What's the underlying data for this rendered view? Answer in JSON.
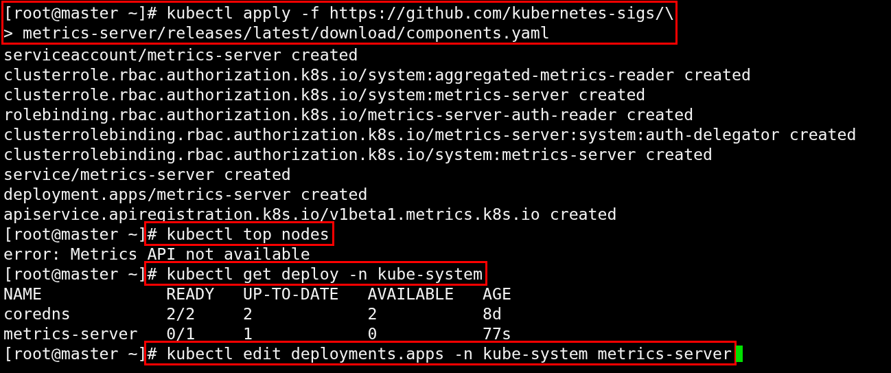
{
  "terminal": {
    "blocks": [
      {
        "prompt": "[root@master ~]",
        "input": [
          "# kubectl apply -f https://github.com/kubernetes-sigs/\\",
          "> metrics-server/releases/latest/download/components.yaml"
        ],
        "boxed": true,
        "box_includes_prompt": true,
        "output": [
          "serviceaccount/metrics-server created",
          "clusterrole.rbac.authorization.k8s.io/system:aggregated-metrics-reader created",
          "clusterrole.rbac.authorization.k8s.io/system:metrics-server created",
          "rolebinding.rbac.authorization.k8s.io/metrics-server-auth-reader created",
          "clusterrolebinding.rbac.authorization.k8s.io/metrics-server:system:auth-delegator created",
          "clusterrolebinding.rbac.authorization.k8s.io/system:metrics-server created",
          "service/metrics-server created",
          "deployment.apps/metrics-server created",
          "apiservice.apiregistration.k8s.io/v1beta1.metrics.k8s.io created"
        ]
      },
      {
        "prompt": "[root@master ~]",
        "input": [
          "# kubectl top nodes"
        ],
        "boxed": true,
        "box_includes_prompt": false,
        "output": [
          "error: Metrics API not available"
        ]
      },
      {
        "prompt": "[root@master ~]",
        "input": [
          "# kubectl get deploy -n kube-system"
        ],
        "boxed": true,
        "box_includes_prompt": false,
        "table": {
          "columns": [
            "NAME",
            "READY",
            "UP-TO-DATE",
            "AVAILABLE",
            "AGE"
          ],
          "rows": [
            [
              "coredns",
              "2/2",
              "2",
              "2",
              "8d"
            ],
            [
              "metrics-server",
              "0/1",
              "1",
              "0",
              "77s"
            ]
          ]
        }
      },
      {
        "prompt": "[root@master ~]",
        "input": [
          "# kubectl edit deployments.apps -n kube-system metrics-server"
        ],
        "boxed": true,
        "box_includes_prompt": false,
        "cursor": true
      }
    ]
  }
}
